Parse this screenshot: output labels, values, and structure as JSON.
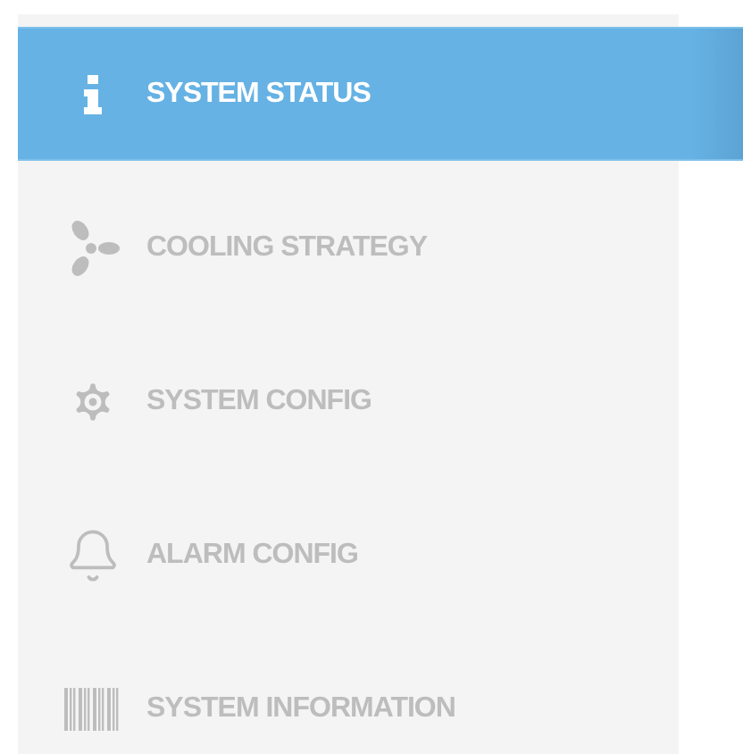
{
  "sidebar": {
    "items": [
      {
        "label": "SYSTEM STATUS",
        "kind": "info",
        "selected": true
      },
      {
        "label": "COOLING STRATEGY",
        "kind": "fan",
        "selected": false
      },
      {
        "label": "SYSTEM CONFIG",
        "kind": "gear",
        "selected": false
      },
      {
        "label": "ALARM CONFIG",
        "kind": "bell",
        "selected": false
      },
      {
        "label": "SYSTEM INFORMATION",
        "kind": "barcode",
        "selected": false
      }
    ]
  }
}
